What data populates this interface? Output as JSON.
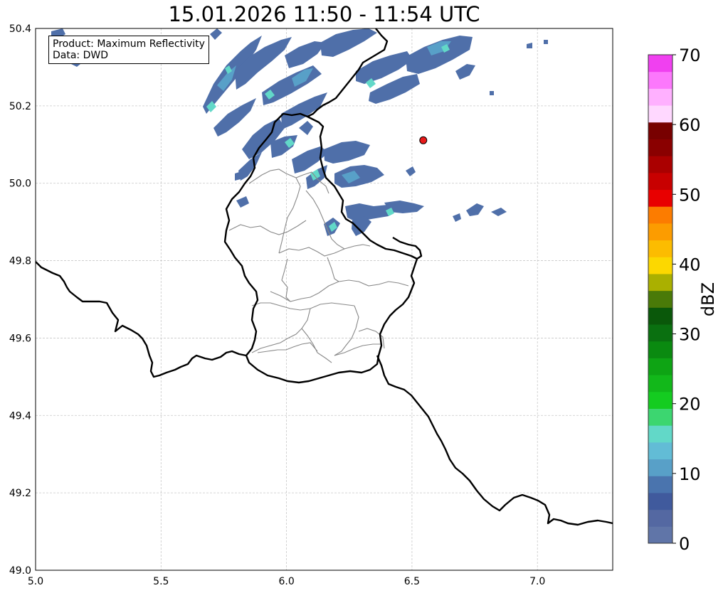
{
  "title": "15.01.2026 11:50 - 11:54 UTC",
  "info": {
    "product_line": "Product: Maximum Reflectivity",
    "data_line": "Data: DWD"
  },
  "map": {
    "lon_range": [
      5.0,
      7.3
    ],
    "lat_range": [
      49.0,
      50.4
    ],
    "x_ticks": [
      "5.0",
      "5.5",
      "6.0",
      "6.5",
      "7.0"
    ],
    "y_ticks": [
      "49.0",
      "49.2",
      "49.4",
      "49.6",
      "49.8",
      "50.0",
      "50.2",
      "50.4"
    ],
    "grid": true,
    "marker": {
      "lon": 6.545,
      "lat": 50.111,
      "color": "#e81a1a"
    }
  },
  "colorbar": {
    "label": "dBZ",
    "ticks": [
      "0",
      "10",
      "20",
      "30",
      "40",
      "50",
      "60",
      "70"
    ],
    "colors": [
      "#6075a8",
      "#5468a2",
      "#405a9d",
      "#4a74ae",
      "#58a0c8",
      "#62bcd6",
      "#62d8c8",
      "#3cd670",
      "#14cc20",
      "#12b81a",
      "#0ea414",
      "#0a8a10",
      "#0a7010",
      "#0a580a",
      "#4a7a08",
      "#aab000",
      "#fcd800",
      "#fcbc00",
      "#fc9c00",
      "#fc7c00",
      "#e80000",
      "#c80000",
      "#aa0000",
      "#8a0000",
      "#780000",
      "#ffd8ff",
      "#ffb0ff",
      "#fc78fc",
      "#f040f0"
    ]
  }
}
